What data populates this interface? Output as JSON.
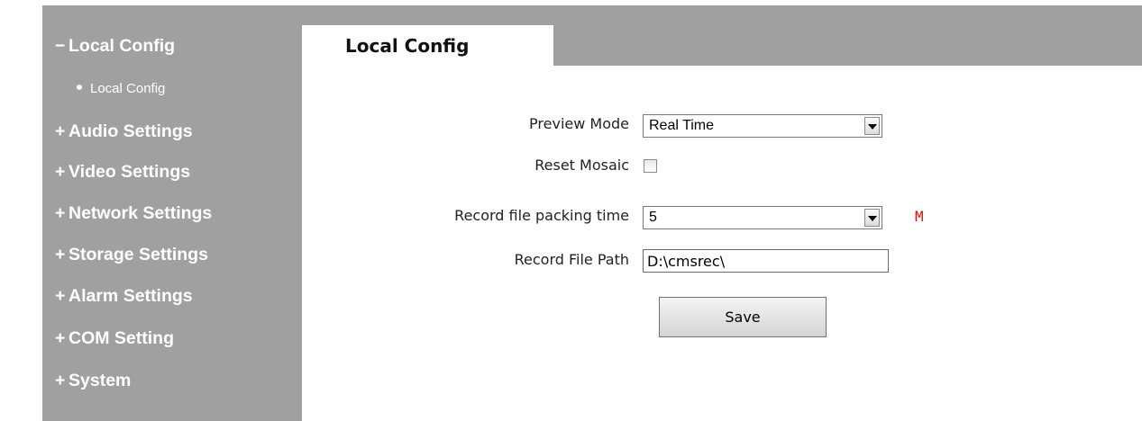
{
  "sidebar": {
    "sections": [
      {
        "sign": "−",
        "label": "Local Config",
        "expanded": true
      },
      {
        "sign": "+",
        "label": "Audio Settings"
      },
      {
        "sign": "+",
        "label": "Video Settings"
      },
      {
        "sign": "+",
        "label": "Network Settings"
      },
      {
        "sign": "+",
        "label": "Storage Settings"
      },
      {
        "sign": "+",
        "label": "Alarm Settings"
      },
      {
        "sign": "+",
        "label": "COM Setting"
      },
      {
        "sign": "+",
        "label": "System"
      }
    ],
    "sub_items": [
      {
        "label": "Local Config"
      }
    ]
  },
  "header": {
    "active_tab": "Local Config"
  },
  "form": {
    "preview_mode": {
      "label": "Preview Mode",
      "value": "Real Time"
    },
    "reset_mosaic": {
      "label": "Reset Mosaic",
      "checked": false
    },
    "packing_time": {
      "label": "Record file packing time",
      "value": "5",
      "unit": "M"
    },
    "file_path": {
      "label": "Record File Path",
      "value": "D:\\cmsrec\\"
    },
    "save_label": "Save"
  },
  "colors": {
    "sidebar_bg": "#a0a0a0",
    "header_bg": "#a0a0a0",
    "unit_color": "#e01010"
  },
  "icons": {
    "select_arrow": "chevron-down-icon",
    "bullet": "dot-icon"
  }
}
